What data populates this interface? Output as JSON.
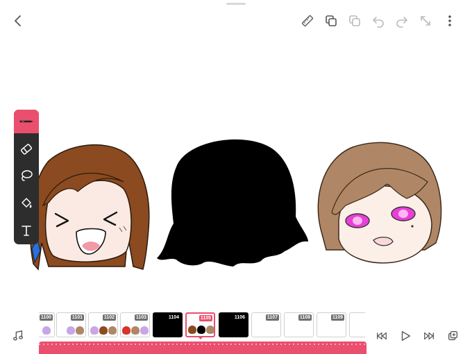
{
  "app": {
    "accent_color": "#ea4f6e",
    "panel_color": "#2d2d2d"
  },
  "topbar": {
    "left": [
      {
        "name": "back",
        "icon": "chevron-left-icon"
      }
    ],
    "right": [
      {
        "name": "ruler",
        "icon": "ruler-icon"
      },
      {
        "name": "layers",
        "icon": "layers-icon"
      },
      {
        "name": "onion-skin",
        "icon": "onion-skin-icon"
      },
      {
        "name": "undo",
        "icon": "undo-icon"
      },
      {
        "name": "redo",
        "icon": "redo-icon"
      },
      {
        "name": "fullscreen",
        "icon": "expand-icon"
      },
      {
        "name": "more",
        "icon": "more-vertical-icon"
      }
    ]
  },
  "tools": [
    {
      "name": "pen",
      "icon": "pen-icon",
      "active": true
    },
    {
      "name": "eraser",
      "icon": "eraser-icon",
      "active": false
    },
    {
      "name": "lasso",
      "icon": "lasso-icon",
      "active": false
    },
    {
      "name": "fill",
      "icon": "paint-bucket-icon",
      "active": false
    },
    {
      "name": "text",
      "icon": "text-icon",
      "active": false
    }
  ],
  "timeline": {
    "selected_frame": "1105",
    "frames": [
      {
        "number": "1100",
        "style": "partial"
      },
      {
        "number": "1101",
        "style": "thumbs"
      },
      {
        "number": "1102",
        "style": "thumbs"
      },
      {
        "number": "1103",
        "style": "thumbs"
      },
      {
        "number": "1104",
        "style": "black"
      },
      {
        "number": "1105",
        "style": "thumbs"
      },
      {
        "number": "1106",
        "style": "black"
      },
      {
        "number": "1107",
        "style": "blank"
      },
      {
        "number": "1108",
        "style": "blank"
      },
      {
        "number": "1109",
        "style": "blank"
      }
    ]
  },
  "playback": [
    {
      "name": "audio",
      "icon": "music-note-icon"
    },
    {
      "name": "jump-start",
      "icon": "skip-back-icon"
    },
    {
      "name": "play",
      "icon": "play-icon"
    },
    {
      "name": "jump-end",
      "icon": "skip-forward-icon"
    },
    {
      "name": "add-frame",
      "icon": "add-frame-icon"
    }
  ]
}
